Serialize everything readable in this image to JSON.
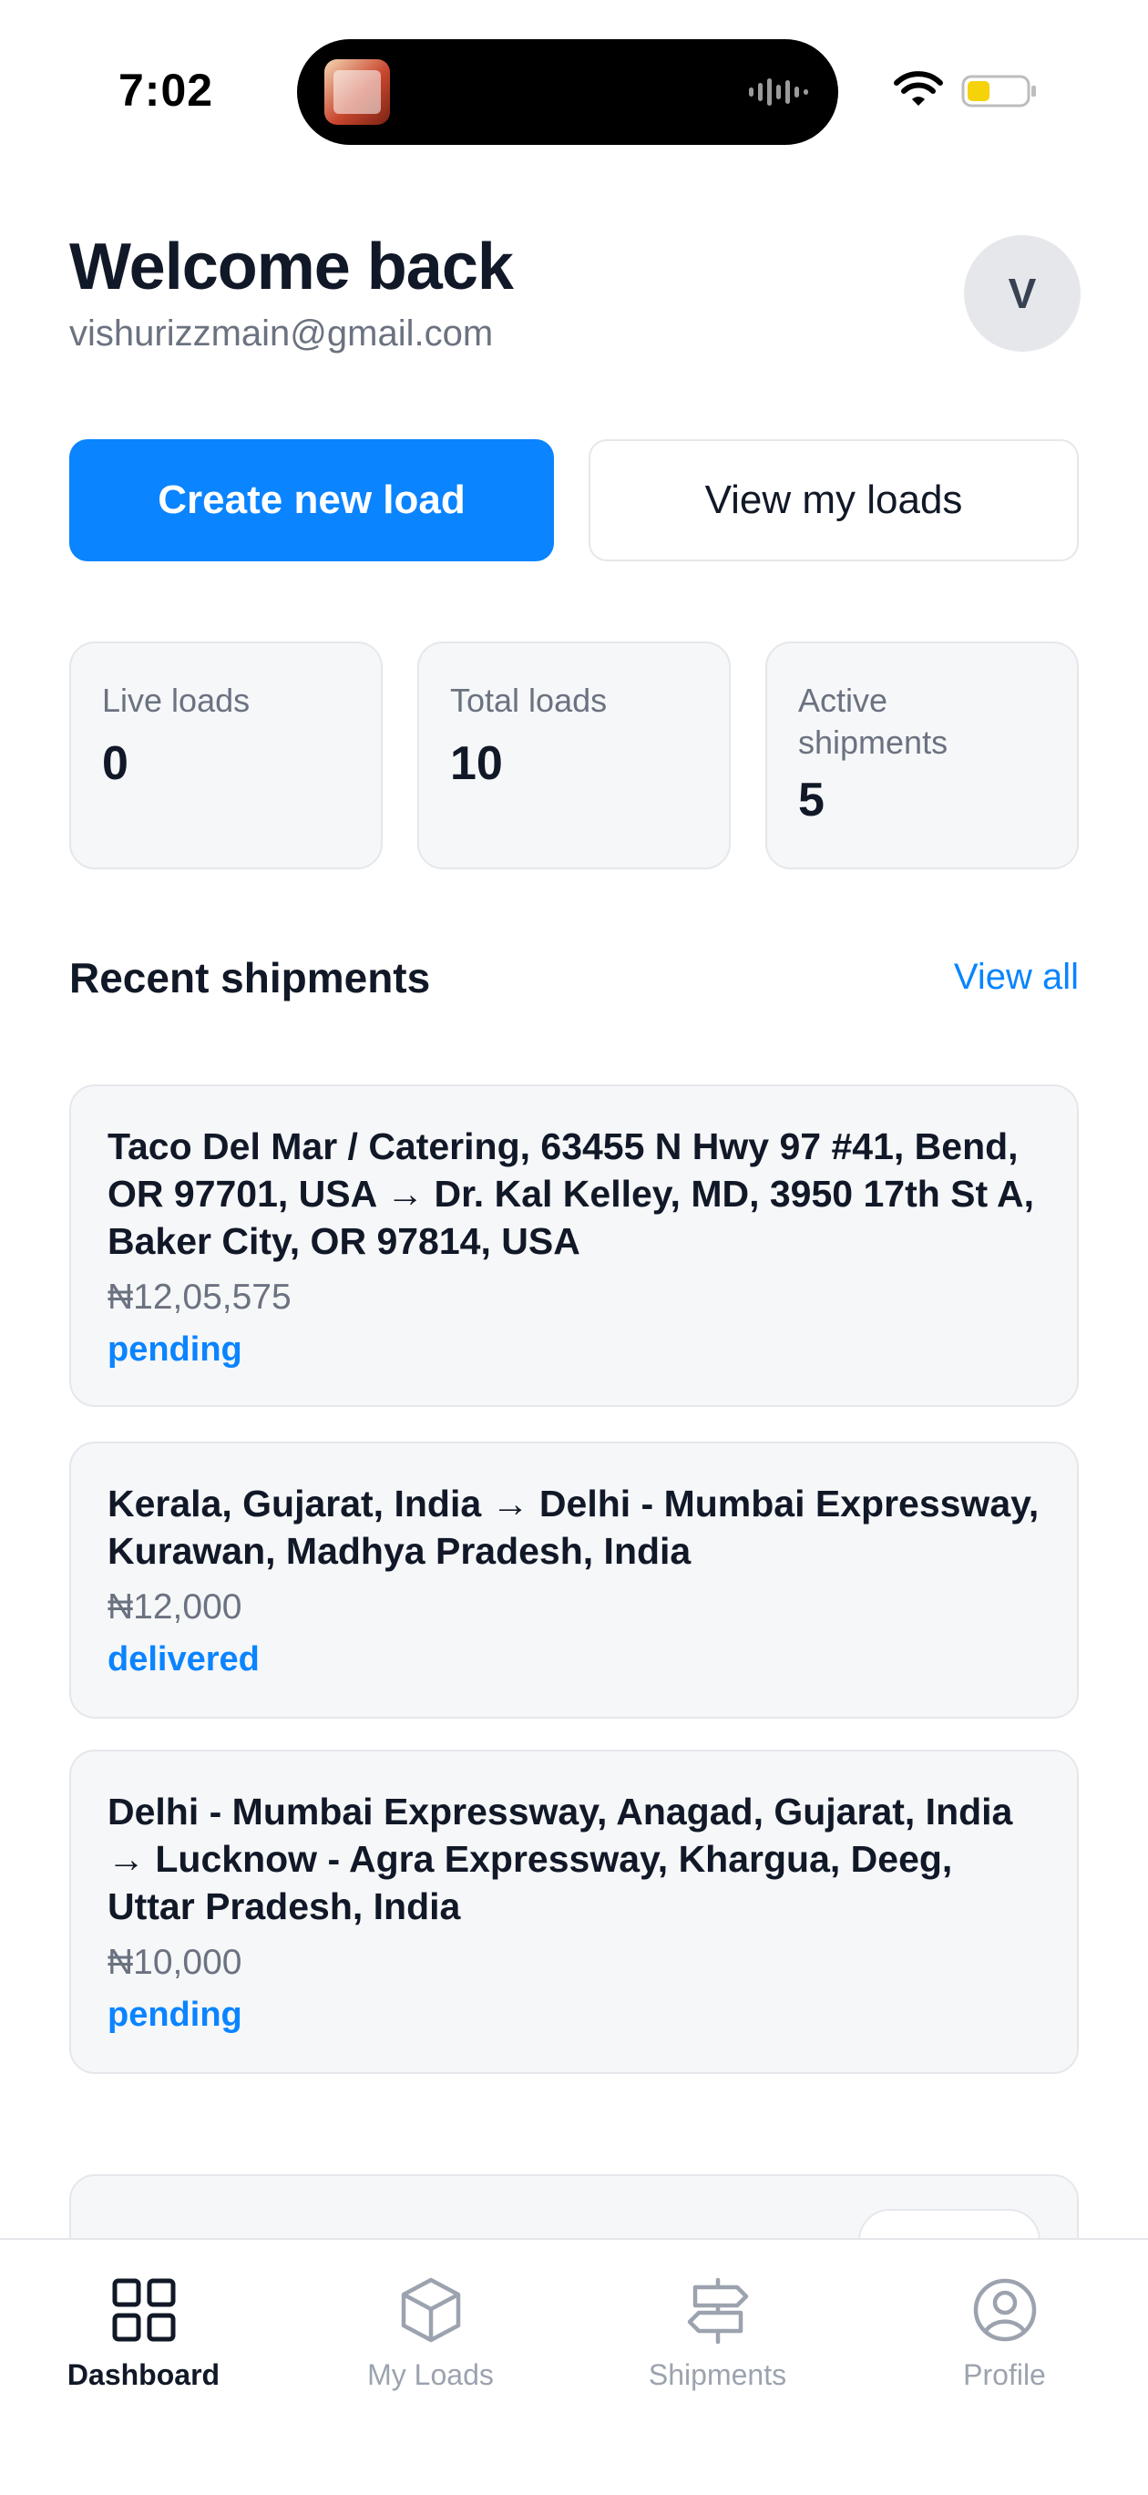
{
  "status_bar": {
    "time": "7:02"
  },
  "header": {
    "title": "Welcome back",
    "email": "vishurizzmain@gmail.com",
    "avatar_initial": "V"
  },
  "actions": {
    "create_label": "Create new load",
    "view_label": "View my loads"
  },
  "stats": [
    {
      "label": "Live loads",
      "value": "0"
    },
    {
      "label": "Total loads",
      "value": "10"
    },
    {
      "label": "Active shipments",
      "value": "5"
    }
  ],
  "recent": {
    "title": "Recent shipments",
    "view_all": "View all",
    "items": [
      {
        "route": "Taco Del Mar / Catering, 63455 N Hwy 97 #41, Bend, OR 97701, USA → Dr. Kal Kelley, MD, 3950 17th St A, Baker City, OR 97814, USA",
        "price": "₦12,05,575",
        "status": "pending"
      },
      {
        "route": "Kerala, Gujarat, India → Delhi - Mumbai Expressway, Kurawan, Madhya Pradesh, India",
        "price": "₦12,000",
        "status": "delivered"
      },
      {
        "route": "Delhi - Mumbai Expressway, Anagad, Gujarat, India → Lucknow - Agra Expressway, Khargua, Deeg, Uttar Pradesh, India",
        "price": "₦10,000",
        "status": "pending"
      }
    ]
  },
  "tabs": [
    {
      "label": "Dashboard",
      "icon": "grid-icon",
      "active": true
    },
    {
      "label": "My Loads",
      "icon": "cube-icon",
      "active": false
    },
    {
      "label": "Shipments",
      "icon": "signpost-icon",
      "active": false
    },
    {
      "label": "Profile",
      "icon": "user-circle-icon",
      "active": false
    }
  ],
  "colors": {
    "accent": "#0a84ff",
    "text": "#111827",
    "muted": "#6b7280",
    "card_bg": "#f6f7f9",
    "border": "#e5e7eb"
  }
}
